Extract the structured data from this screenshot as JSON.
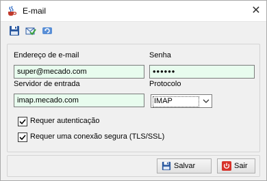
{
  "window": {
    "title": "E-mail",
    "close_glyph": "✕"
  },
  "toolbar": {
    "icons": [
      {
        "name": "save-icon"
      },
      {
        "name": "check-mail-icon"
      },
      {
        "name": "refresh-icon"
      }
    ]
  },
  "form": {
    "email_label": "Endereço de e-mail",
    "email_value": "super@mecado.com",
    "password_label": "Senha",
    "password_value": "••••••",
    "server_label": "Servidor de entrada",
    "server_value": "imap.mecado.com",
    "protocol_label": "Protocolo",
    "protocol_value": "IMAP",
    "protocol_options": [
      "IMAP"
    ],
    "require_auth_label": "Requer autenticação",
    "require_auth_checked": true,
    "require_secure_label": "Requer uma conexão segura (TLS/SSL)",
    "require_secure_checked": true
  },
  "footer": {
    "save_label": "Salvar",
    "exit_label": "Sair"
  },
  "colors": {
    "field_bg": "#e8fcee",
    "accent_blue": "#1f5fbf",
    "exit_red": "#d7322a"
  }
}
